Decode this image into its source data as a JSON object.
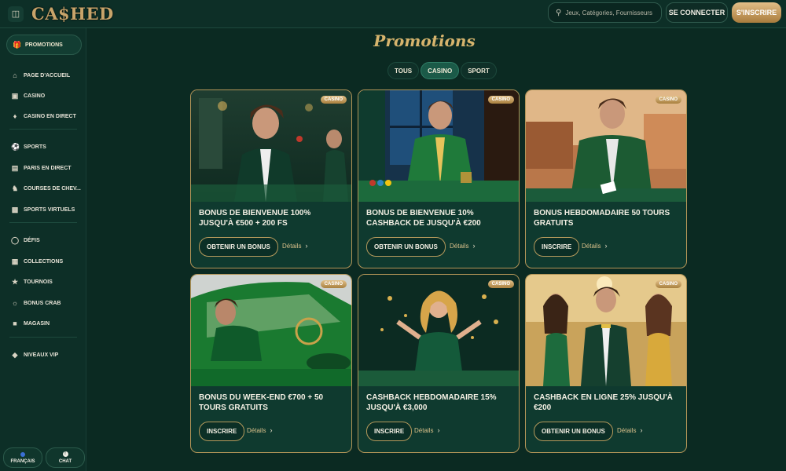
{
  "header": {
    "logo": "CA$HED",
    "search_placeholder": "Jeux, Catégories, Fournisseurs",
    "login_label": "SE CONNECTER",
    "signup_label": "S'INSCRIRE"
  },
  "sidebar": {
    "promo_label": "PROMOTIONS",
    "items": [
      {
        "label": "PAGE D'ACCUEIL",
        "icon": "home-icon"
      },
      {
        "label": "CASINO",
        "icon": "casino-icon"
      },
      {
        "label": "CASINO EN DIRECT",
        "icon": "live-casino-icon"
      },
      {
        "label": "SPORTS",
        "icon": "sports-icon"
      },
      {
        "label": "PARIS EN DIRECT",
        "icon": "live-bet-icon"
      },
      {
        "label": "COURSES DE CHEV...",
        "icon": "horse-icon"
      },
      {
        "label": "SPORTS VIRTUELS",
        "icon": "virtual-sports-icon"
      },
      {
        "label": "DÉFIS",
        "icon": "challenges-icon"
      },
      {
        "label": "COLLECTIONS",
        "icon": "collections-icon"
      },
      {
        "label": "TOURNOIS",
        "icon": "trophy-icon"
      },
      {
        "label": "BONUS CRAB",
        "icon": "crab-icon"
      },
      {
        "label": "MAGASIN",
        "icon": "shop-icon"
      },
      {
        "label": "NIVEAUX VIP",
        "icon": "diamond-icon"
      }
    ],
    "language_label": "FRANÇAIS",
    "chat_label": "CHAT"
  },
  "main": {
    "title": "Promotions",
    "tabs": [
      {
        "label": "TOUS",
        "active": false
      },
      {
        "label": "CASINO",
        "active": true
      },
      {
        "label": "SPORT",
        "active": false
      }
    ],
    "cards": [
      {
        "badge": "CASINO",
        "title": "BONUS DE BIENVENUE 100% JUSQU'À €500 + 200 FS",
        "action": "OBTENIR UN BONUS",
        "details": "Détails"
      },
      {
        "badge": "CASINO",
        "title": "BONUS DE BIENVENUE 10% CASHBACK DE JUSQU'À €200",
        "action": "OBTENIR UN BONUS",
        "details": "Détails"
      },
      {
        "badge": "CASINO",
        "title": "BONUS HEBDOMADAIRE 50 TOURS GRATUITS",
        "action": "INSCRIRE",
        "details": "Détails"
      },
      {
        "badge": "CASINO",
        "title": "BONUS DU WEEK-END €700 + 50 TOURS GRATUITS",
        "action": "INSCRIRE",
        "details": "Détails"
      },
      {
        "badge": "CASINO",
        "title": "CASHBACK HEBDOMADAIRE 15% JUSQU'À €3,000",
        "action": "INSCRIRE",
        "details": "Détails"
      },
      {
        "badge": "CASINO",
        "title": "CASHBACK EN LIGNE 25% JUSQU'À €200",
        "action": "OBTENIR UN BONUS",
        "details": "Détails"
      }
    ]
  },
  "colors": {
    "background": "#0b2a22",
    "accent_gold": "#d6b46d",
    "active_tab": "#1b5a48"
  }
}
